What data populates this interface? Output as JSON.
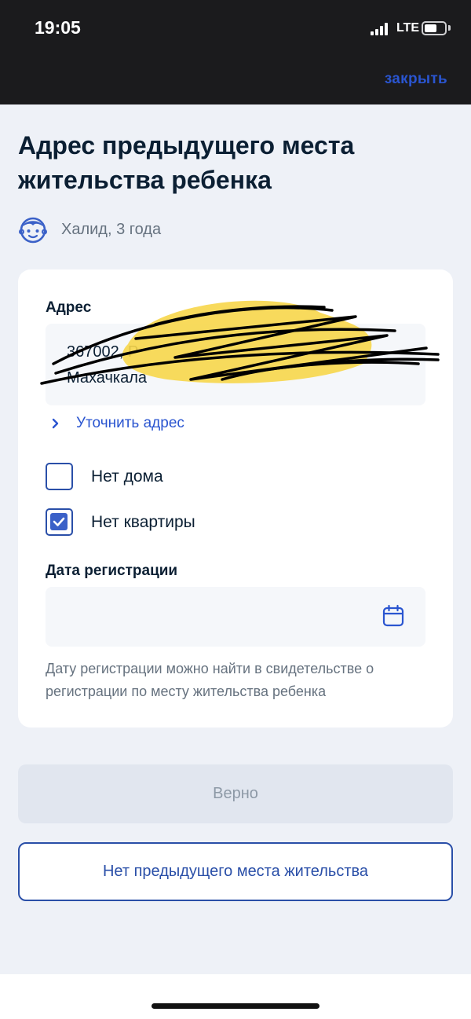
{
  "status_bar": {
    "time": "19:05",
    "network": "LTE"
  },
  "header": {
    "close_label": "закрыть"
  },
  "page": {
    "title": "Адрес предыдущего места жительства ребенка",
    "child_icon": "child-face-icon",
    "child_name": "Халид, 3 года"
  },
  "form": {
    "address_label": "Адрес",
    "address_line1": "367002, Р",
    "address_line2": "Махачкала",
    "refine_label": "Уточнить адрес",
    "no_house_label": "Нет дома",
    "no_house_checked": false,
    "no_apartment_label": "Нет квартиры",
    "no_apartment_checked": true,
    "date_label": "Дата регистрации",
    "date_value": "",
    "date_icon": "calendar-icon",
    "hint": "Дату регистрации можно найти в свидетельстве о регистрации по месту жительства ребенка"
  },
  "actions": {
    "confirm_label": "Верно",
    "no_previous_label": "Нет предыдущего места жительства"
  },
  "colors": {
    "accent": "#2a55d0",
    "outline": "#2a4fa8",
    "background": "#eef1f7",
    "redaction_yellow": "#f7d64a"
  }
}
